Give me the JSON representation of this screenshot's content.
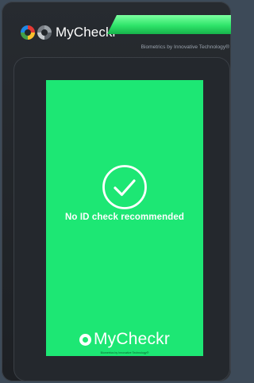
{
  "header": {
    "brand_name": "MyCheckr",
    "tagline": "Biometrics by Innovative Technology®",
    "logo_icon_primary": "mycheckr-logo-color-icon",
    "logo_icon_secondary": "mycheckr-logo-mono-icon",
    "status_led_color": "#2ee46a"
  },
  "screen": {
    "background_color": "#1de774",
    "status_icon": "checkmark-circle-icon",
    "result_text": "No ID check recommended",
    "footer_brand": "MyCheckr",
    "footer_logo_icon": "mycheckr-logo-icon",
    "footer_tagline": "Biometrics by Innovative Technology®"
  }
}
